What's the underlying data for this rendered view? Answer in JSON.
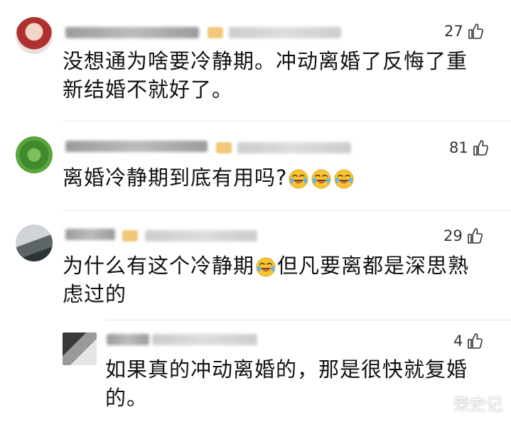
{
  "comments": [
    {
      "username": "托苏吉贵 8478",
      "location": "浙江",
      "time": "18小时前",
      "likes": "27",
      "text_lines": [
        "没想通为啥要冷静期。冲动离婚了反悔了重",
        "新结婚不就好了。"
      ]
    },
    {
      "username": "宝宝如何收场",
      "location": "上海",
      "time": "18小时前",
      "likes": "81",
      "text_lines": [
        "离婚冷静期到底有用吗?"
      ],
      "emoji_count": 3
    },
    {
      "username": "T因 T",
      "location": "江苏",
      "time": "18小时前",
      "likes": "29",
      "text_line1_before": "为什么有这个冷静期",
      "text_line1_after": "但凡要离都是深思熟",
      "text_line2": "虑过的"
    },
    {
      "username": "佳 Li",
      "location": "广西",
      "time": "18小时前",
      "likes": "4",
      "text_lines": [
        "如果真的冲动离婚的，那是很快就复婚",
        "的。"
      ]
    }
  ],
  "watermark": "荣史记",
  "icons": {
    "like": "thumbs-up-icon",
    "emoji": "laughing-crying-emoji-icon"
  },
  "colors": {
    "badge": "#f1c77a",
    "text": "#111111",
    "meta": "#9a9a9a",
    "watermark": "#ffffff"
  }
}
